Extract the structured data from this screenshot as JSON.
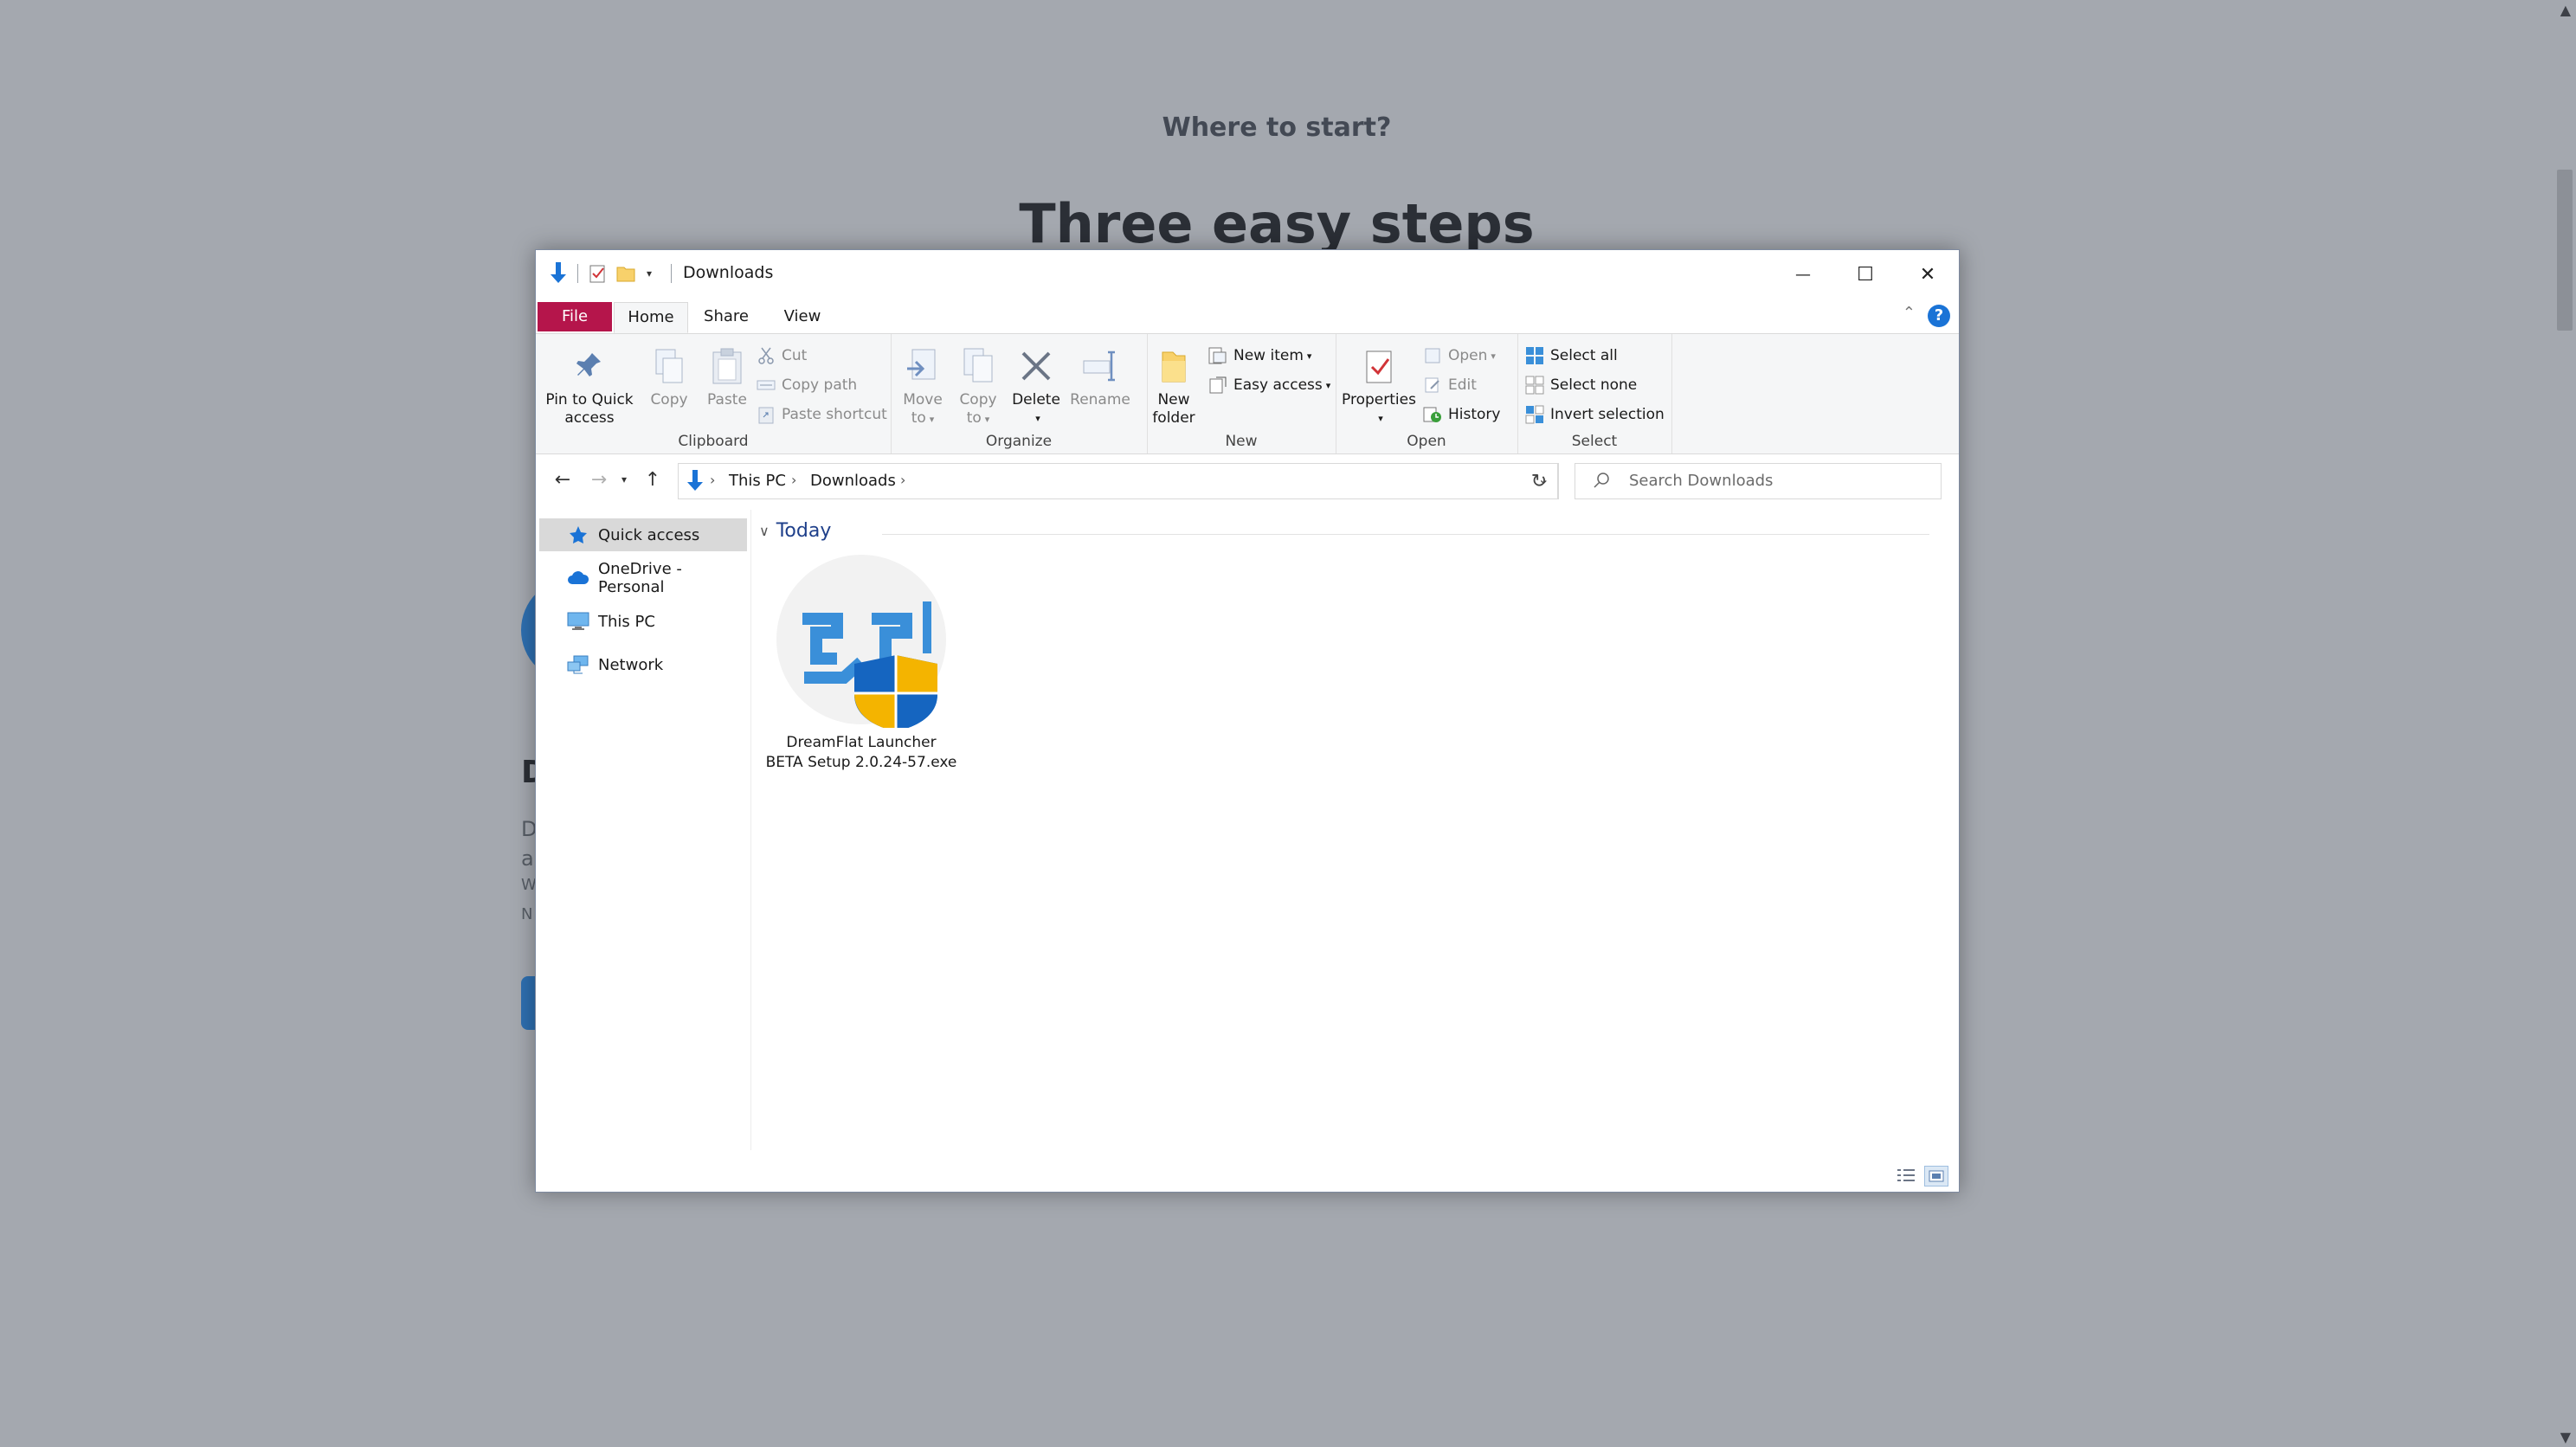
{
  "background_page": {
    "eyebrow": "Where to start?",
    "title": "Three easy steps",
    "heading_fragment": "D",
    "text_fragments": [
      "D",
      "a",
      "W",
      "N"
    ]
  },
  "window": {
    "title": "Downloads",
    "controls": {
      "minimize": "—",
      "maximize": "☐",
      "close": "✕"
    }
  },
  "ribbon": {
    "tabs": [
      {
        "label": "File"
      },
      {
        "label": "Home"
      },
      {
        "label": "Share"
      },
      {
        "label": "View"
      }
    ],
    "help": "?",
    "clipboard": {
      "label": "Clipboard",
      "pin": "Pin to Quick access",
      "pin_line1": "Pin to Quick",
      "pin_line2": "access",
      "copy": "Copy",
      "paste": "Paste",
      "cut": "Cut",
      "copy_path": "Copy path",
      "paste_shortcut": "Paste shortcut"
    },
    "organize": {
      "label": "Organize",
      "move_to_1": "Move",
      "move_to_2": "to",
      "copy_to_1": "Copy",
      "copy_to_2": "to",
      "delete": "Delete",
      "rename": "Rename"
    },
    "new": {
      "label": "New",
      "new_folder_1": "New",
      "new_folder_2": "folder",
      "new_item": "New item",
      "easy_access": "Easy access"
    },
    "open": {
      "label": "Open",
      "properties": "Properties",
      "open": "Open",
      "edit": "Edit",
      "history": "History"
    },
    "select": {
      "label": "Select",
      "select_all": "Select all",
      "select_none": "Select none",
      "invert": "Invert selection"
    }
  },
  "address": {
    "crumbs": [
      "This PC",
      "Downloads"
    ],
    "search_placeholder": "Search Downloads"
  },
  "nav_pane": {
    "items": [
      {
        "label": "Quick access",
        "selected": true
      },
      {
        "label": "OneDrive - Personal"
      },
      {
        "label": "This PC"
      },
      {
        "label": "Network"
      }
    ]
  },
  "content": {
    "group": "Today",
    "files": [
      {
        "line1": "DreamFlat Launcher",
        "line2": "BETA Setup 2.0.24-57.exe"
      }
    ]
  },
  "colors": {
    "file_tab": "#b5154b",
    "accent_blue": "#1a73d6",
    "group_header": "#1e3f8a",
    "shield_blue": "#1565c0",
    "shield_yellow": "#f4b400",
    "launcher_blue": "#3a8fd9"
  }
}
